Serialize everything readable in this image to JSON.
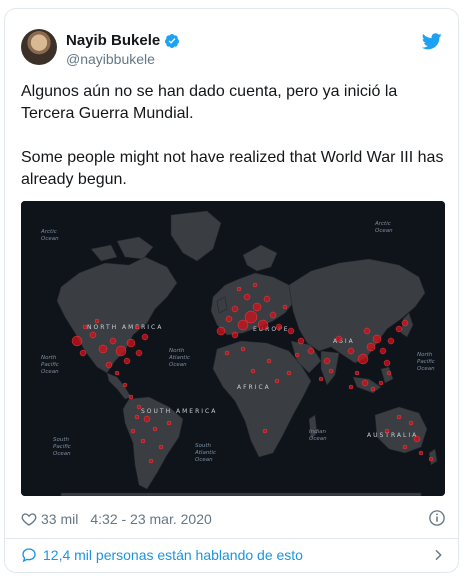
{
  "tweet": {
    "author": {
      "display_name": "Nayib Bukele",
      "handle": "@nayibbukele",
      "verified": true
    },
    "text_es": "Algunos aún no se han dado cuenta, pero ya inició la Tercera Guerra Mundial.",
    "text_en": "Some people might not have realized that World War III has already begun.",
    "likes": "33 mil",
    "timestamp": "4:32 - 23 mar. 2020",
    "conversation_label": "12,4 mil personas están hablando de esto"
  },
  "map": {
    "continents": {
      "north_america": "NORTH AMERICA",
      "south_america": "SOUTH AMERICA",
      "europe": "EUROPE",
      "asia": "ASIA",
      "africa": "AFRICA",
      "australia": "AUSTRALIA"
    },
    "oceans": {
      "arctic_left_1": "Arctic",
      "arctic_left_2": "Ocean",
      "arctic_right_1": "Arctic",
      "arctic_right_2": "Ocean",
      "north_pacific_left_1": "North",
      "north_pacific_left_2": "Pacific",
      "north_pacific_left_3": "Ocean",
      "north_atlantic_1": "North",
      "north_atlantic_2": "Atlantic",
      "north_atlantic_3": "Ocean",
      "north_pacific_right_1": "North",
      "north_pacific_right_2": "Pacific",
      "north_pacific_right_3": "Ocean",
      "south_pacific_1": "South",
      "south_pacific_2": "Pacific",
      "south_pacific_3": "Ocean",
      "south_atlantic_1": "South",
      "south_atlantic_2": "Atlantic",
      "south_atlantic_3": "Ocean",
      "indian_1": "Indian",
      "indian_2": "Ocean"
    }
  },
  "colors": {
    "link_blue": "#1b95e0",
    "twitter_blue": "#1da1f2",
    "map_background": "#0f131a",
    "land": "#3a3d42",
    "case_marker": "#d4121b"
  },
  "icons": [
    "verified-badge-icon",
    "twitter-bird-icon",
    "heart-icon",
    "info-icon",
    "speech-bubble-icon",
    "chevron-right-icon"
  ]
}
